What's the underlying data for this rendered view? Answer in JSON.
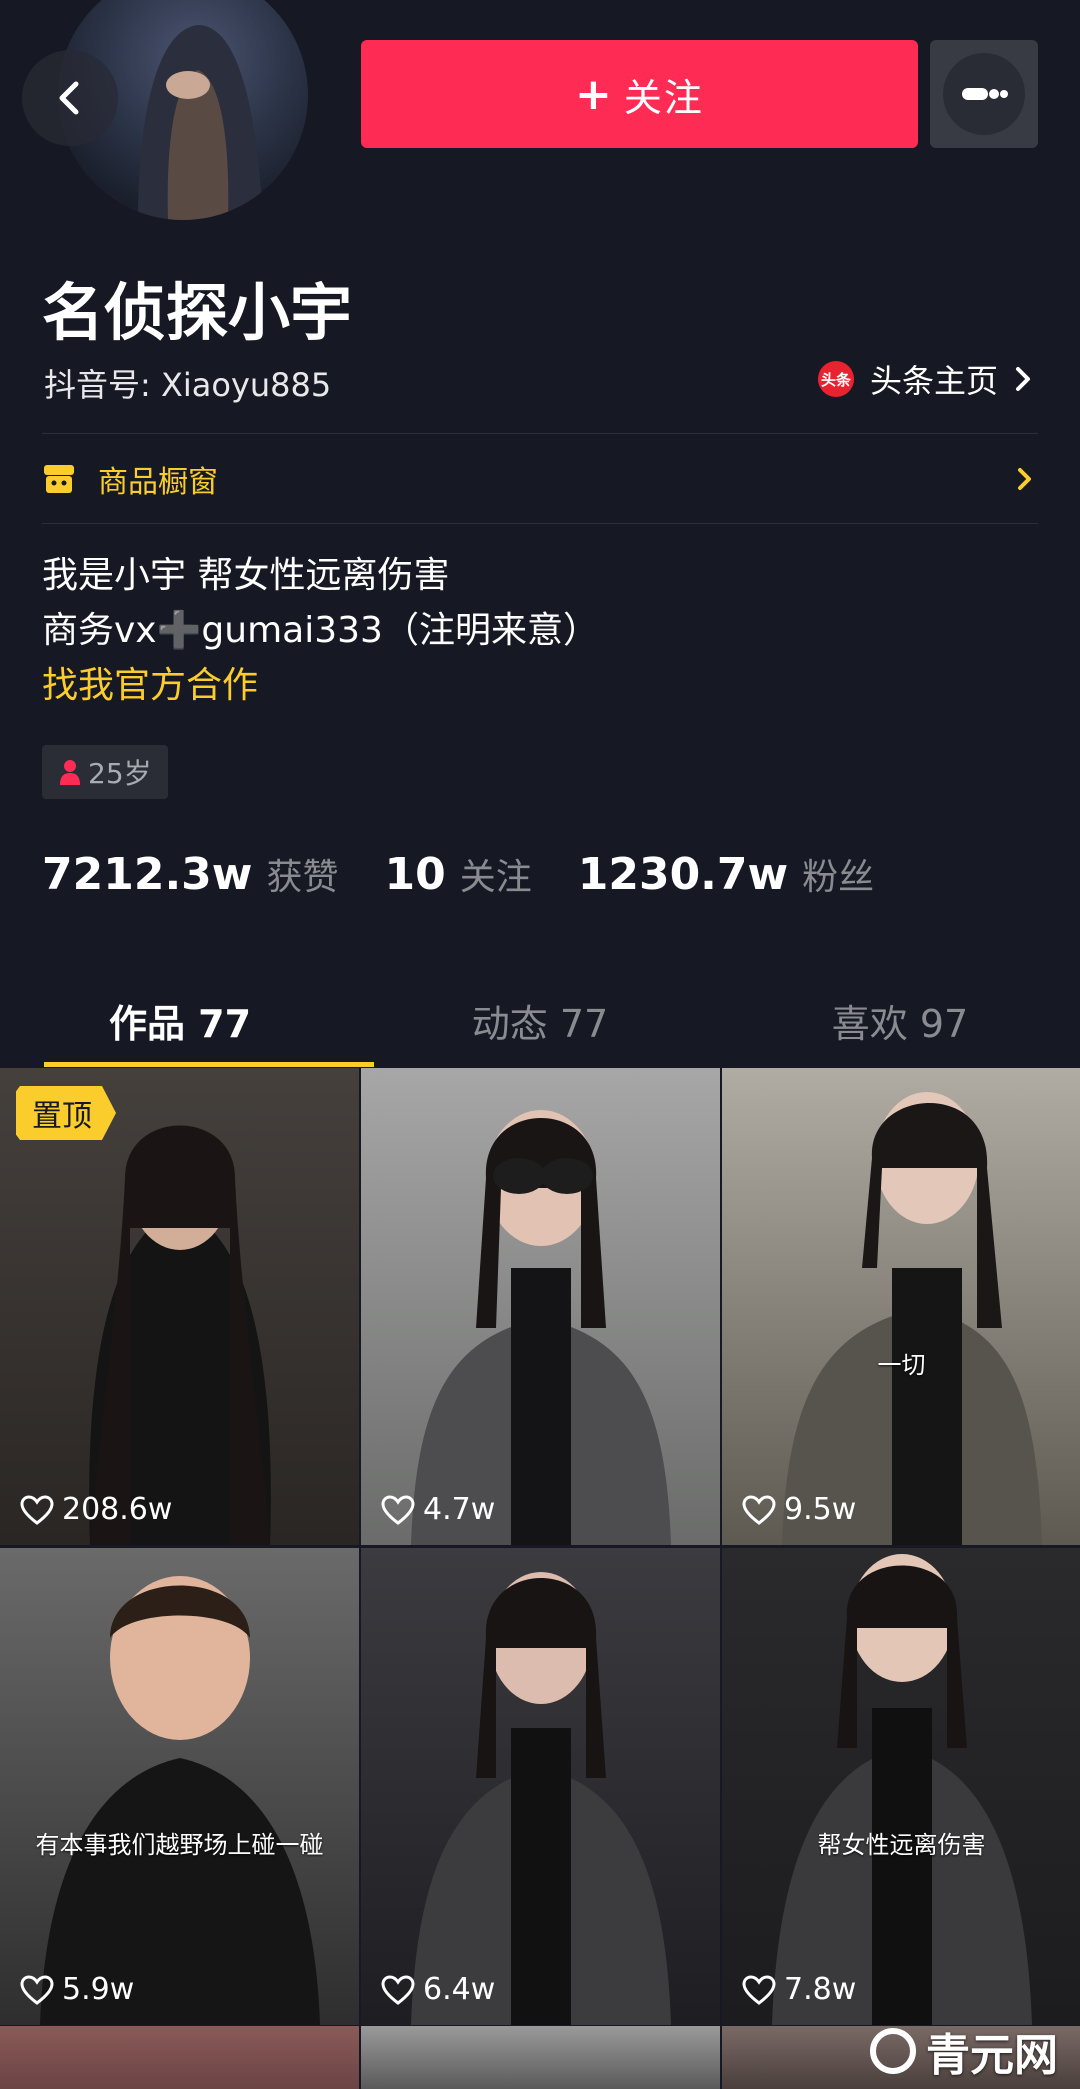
{
  "header": {
    "back_icon": "chevron-left-icon",
    "follow_label": "关注",
    "more_icon": "more-dots-icon"
  },
  "profile": {
    "name": "名侦探小宇",
    "douyin_id": "抖音号: Xiaoyu885",
    "toutiao_badge": "头条",
    "toutiao_label": "头条主页",
    "shop_label": "商品橱窗",
    "bio_line1": "我是小宇 帮女性远离伤害",
    "bio_line2": "商务vx➕gumai333（注明来意）",
    "bio_link": "找我官方合作",
    "age": "25岁"
  },
  "stats": {
    "likes_num": "7212.3w",
    "likes_label": "获赞",
    "following_num": "10",
    "following_label": "关注",
    "followers_num": "1230.7w",
    "followers_label": "粉丝"
  },
  "tabs": [
    {
      "label": "作品 77"
    },
    {
      "label": "动态 77"
    },
    {
      "label": "喜欢 97"
    }
  ],
  "videos": [
    {
      "likes": "208.6w",
      "pinned": "置顶",
      "caption": "",
      "bg": "#3a3633"
    },
    {
      "likes": "4.7w",
      "caption": "",
      "bg": "#8d8e8d"
    },
    {
      "likes": "9.5w",
      "caption": "一切",
      "bg": "#6e6b64"
    },
    {
      "likes": "5.9w",
      "caption": "有本事我们越野场上碰一碰",
      "bg": "#4a4a4a"
    },
    {
      "likes": "6.4w",
      "caption": "",
      "bg": "#2f2f33"
    },
    {
      "likes": "7.8w",
      "caption": "帮女性远离伤害",
      "bg": "#2c2c2e"
    }
  ],
  "watermark": "青元网",
  "colors": {
    "accent_red": "#fe2c55",
    "accent_yellow": "#facd2d",
    "background": "#161823"
  }
}
